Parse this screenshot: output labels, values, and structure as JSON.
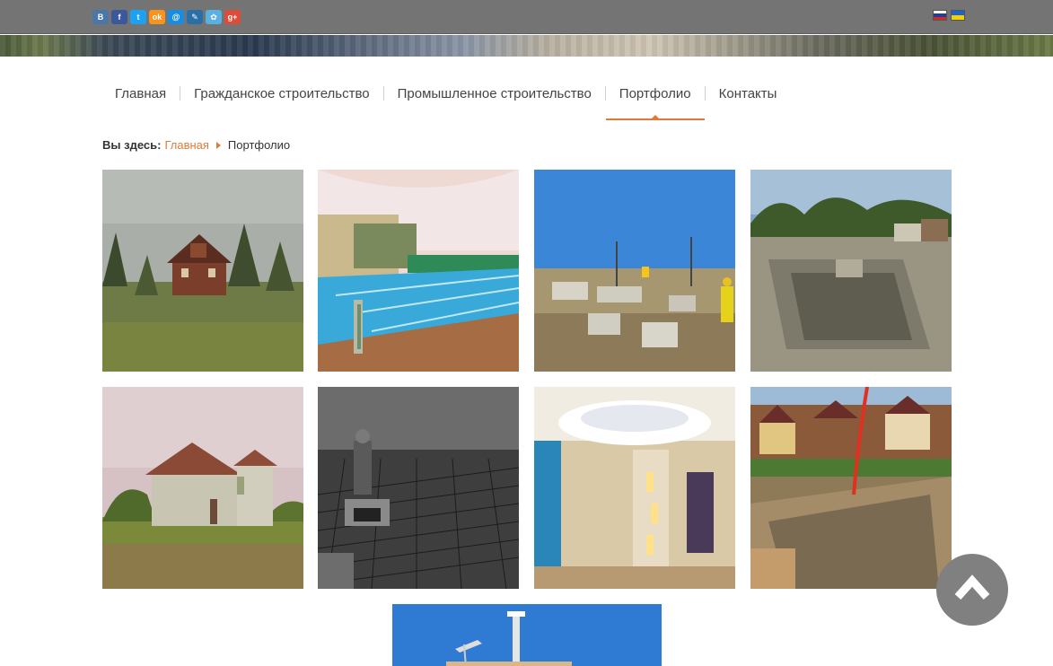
{
  "social": {
    "icons": [
      {
        "name": "vkontakte-icon",
        "glyph": "В",
        "color": "#4a76a8"
      },
      {
        "name": "facebook-icon",
        "glyph": "f",
        "color": "#3b5998"
      },
      {
        "name": "twitter-icon",
        "glyph": "t",
        "color": "#1da1f2"
      },
      {
        "name": "odnoklassniki-icon",
        "glyph": "ok",
        "color": "#f7931e"
      },
      {
        "name": "mailru-icon",
        "glyph": "@",
        "color": "#168de2"
      },
      {
        "name": "livejournal-icon",
        "glyph": "✎",
        "color": "#2b6fa7"
      },
      {
        "name": "moimir-icon",
        "glyph": "✿",
        "color": "#5ab0e0"
      },
      {
        "name": "googleplus-icon",
        "glyph": "g+",
        "color": "#dd4b39"
      }
    ]
  },
  "languages": [
    {
      "name": "russian-flag-icon",
      "colors": [
        "#ffffff",
        "#1c3fa0",
        "#d52b1e"
      ]
    },
    {
      "name": "ukrainian-flag-icon",
      "colors": [
        "#1e64c8",
        "#f5d000"
      ]
    }
  ],
  "nav": {
    "items": [
      {
        "label": "Главная",
        "active": false
      },
      {
        "label": "Гражданское строительство",
        "active": false
      },
      {
        "label": "Промышленное строительство",
        "active": false
      },
      {
        "label": "Портфолио",
        "active": true
      },
      {
        "label": "Контакты",
        "active": false
      }
    ]
  },
  "breadcrumb": {
    "label": "Вы здесь:",
    "home": "Главная",
    "current": "Портфолио"
  },
  "accent_color": "#e07a3a",
  "gallery": {
    "images": [
      {
        "name": "photo-wooden-house",
        "subject": "wooden house in field"
      },
      {
        "name": "photo-indoor-pool",
        "subject": "indoor swimming pool"
      },
      {
        "name": "photo-foundation-site",
        "subject": "foundation construction site"
      },
      {
        "name": "photo-pool-construction",
        "subject": "pool under construction"
      },
      {
        "name": "photo-brick-house",
        "subject": "house under construction"
      },
      {
        "name": "photo-rebar-work",
        "subject": "rebar frame and worker"
      },
      {
        "name": "photo-interior-ceiling",
        "subject": "interior with drywall ceiling"
      },
      {
        "name": "photo-concrete-pump",
        "subject": "concrete pump at site"
      },
      {
        "name": "photo-crane-tower",
        "subject": "tower crane against sky"
      }
    ]
  }
}
